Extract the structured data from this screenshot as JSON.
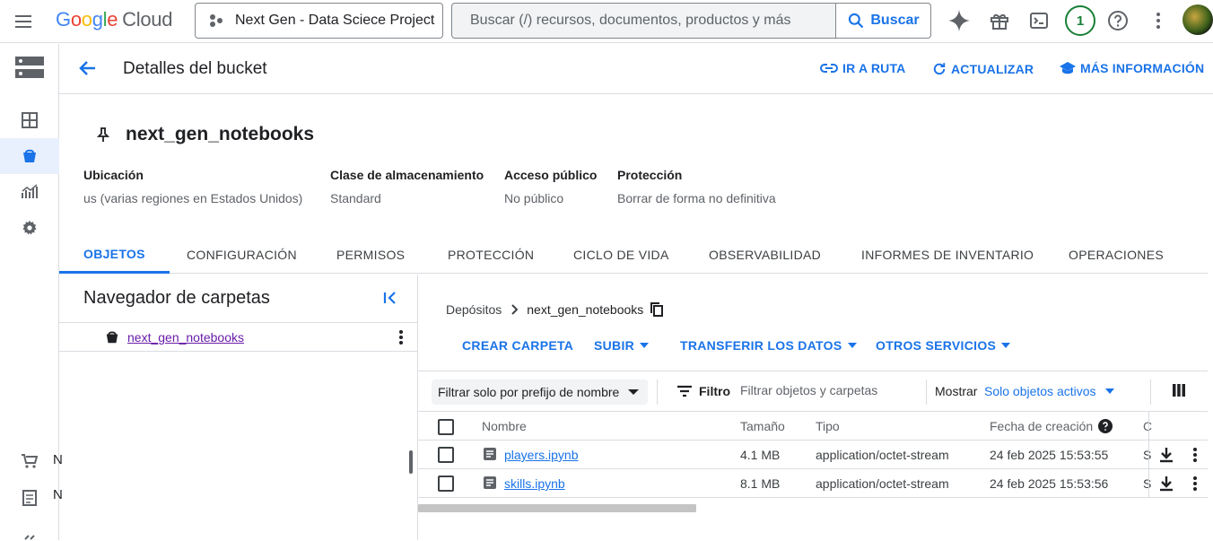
{
  "topbar": {
    "logo": {
      "g": "G",
      "o1": "o",
      "o2": "o",
      "g2": "g",
      "l": "l",
      "e": "e",
      "cloud": "Cloud"
    },
    "project": "Next Gen - Data Sciece Project",
    "search_placeholder": "Buscar (/) recursos, documentos, productos y más",
    "search_button": "Buscar",
    "notification_count": "1"
  },
  "leftnav": {
    "truncated_1": "N",
    "truncated_2": "N"
  },
  "header": {
    "title": "Detalles del bucket",
    "go_to_path": "IR A RUTA",
    "refresh": "ACTUALIZAR",
    "more_info": "MÁS INFORMACIÓN"
  },
  "bucket": {
    "name": "next_gen_notebooks",
    "meta": [
      {
        "key": "Ubicación",
        "value": "us (varias regiones en Estados Unidos)"
      },
      {
        "key": "Clase de almacenamiento",
        "value": "Standard"
      },
      {
        "key": "Acceso público",
        "value": "No público"
      },
      {
        "key": "Protección",
        "value": "Borrar de forma no definitiva"
      }
    ]
  },
  "tabs": [
    "OBJETOS",
    "CONFIGURACIÓN",
    "PERMISOS",
    "PROTECCIÓN",
    "CICLO DE VIDA",
    "OBSERVABILIDAD",
    "INFORMES DE INVENTARIO",
    "OPERACIONES"
  ],
  "folder_browser": {
    "title": "Navegador de carpetas",
    "item": "next_gen_notebooks"
  },
  "breadcrumb": {
    "root": "Depósitos",
    "current": "next_gen_notebooks"
  },
  "actions": {
    "create_folder": "CREAR CARPETA",
    "upload": "SUBIR",
    "transfer": "TRANSFERIR LOS DATOS",
    "other": "OTROS SERVICIOS"
  },
  "filters": {
    "prefix": "Filtrar solo por prefijo de nombre",
    "filter_label": "Filtro",
    "filter_placeholder": "Filtrar objetos y carpetas",
    "show_label": "Mostrar",
    "show_value": "Solo objetos activos"
  },
  "table": {
    "headers": {
      "name": "Nombre",
      "size": "Tamaño",
      "type": "Tipo",
      "created": "Fecha de creación",
      "trunc": "C"
    },
    "rows": [
      {
        "name": "players.ipynb",
        "size": "4.1 MB",
        "type": "application/octet-stream",
        "created": "24 feb 2025 15:53:55",
        "trunc": "S"
      },
      {
        "name": "skills.ipynb",
        "size": "8.1 MB",
        "type": "application/octet-stream",
        "created": "24 feb 2025 15:53:56",
        "trunc": "S"
      }
    ]
  },
  "colors": {
    "accent": "#1a73e8",
    "visited_link": "#681da8",
    "badge": "#188038"
  }
}
